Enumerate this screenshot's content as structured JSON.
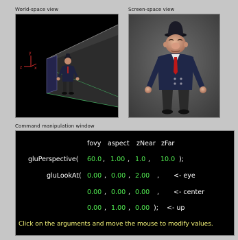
{
  "world_view": {
    "label": "World-space view"
  },
  "screen_view": {
    "label": "Screen-space view"
  },
  "command_window": {
    "label": "Command manipulation window",
    "headers": [
      "fovy",
      "aspect",
      "zNear",
      "zFar"
    ],
    "perspective": {
      "func": "gluPerspective(",
      "values": [
        "60.0",
        "1.00",
        "1.0",
        "10.0"
      ],
      "sep": [
        ",",
        ",",
        ","
      ],
      "close": ");"
    },
    "lookat": {
      "func": "gluLookAt(",
      "eye": [
        "0.00",
        "0.00",
        "2.00"
      ],
      "center": [
        "0.00",
        "0.00",
        "0.00"
      ],
      "up": [
        "0.00",
        "1.00",
        "0.00"
      ],
      "sep": [
        ",",
        ","
      ],
      "eye_trail": ",",
      "center_trail": ",",
      "up_trail": ");",
      "eye_label": "<- eye",
      "center_label": "<- center",
      "up_label": "<- up"
    },
    "instructions": "Click on the arguments and move the mouse to modify values."
  },
  "colors": {
    "background": "#c6c6c6",
    "value_green": "#52ef52",
    "hint_yellow": "#f5f57a",
    "text_white": "#ffffff",
    "frustum_green": "#3fa35a"
  }
}
